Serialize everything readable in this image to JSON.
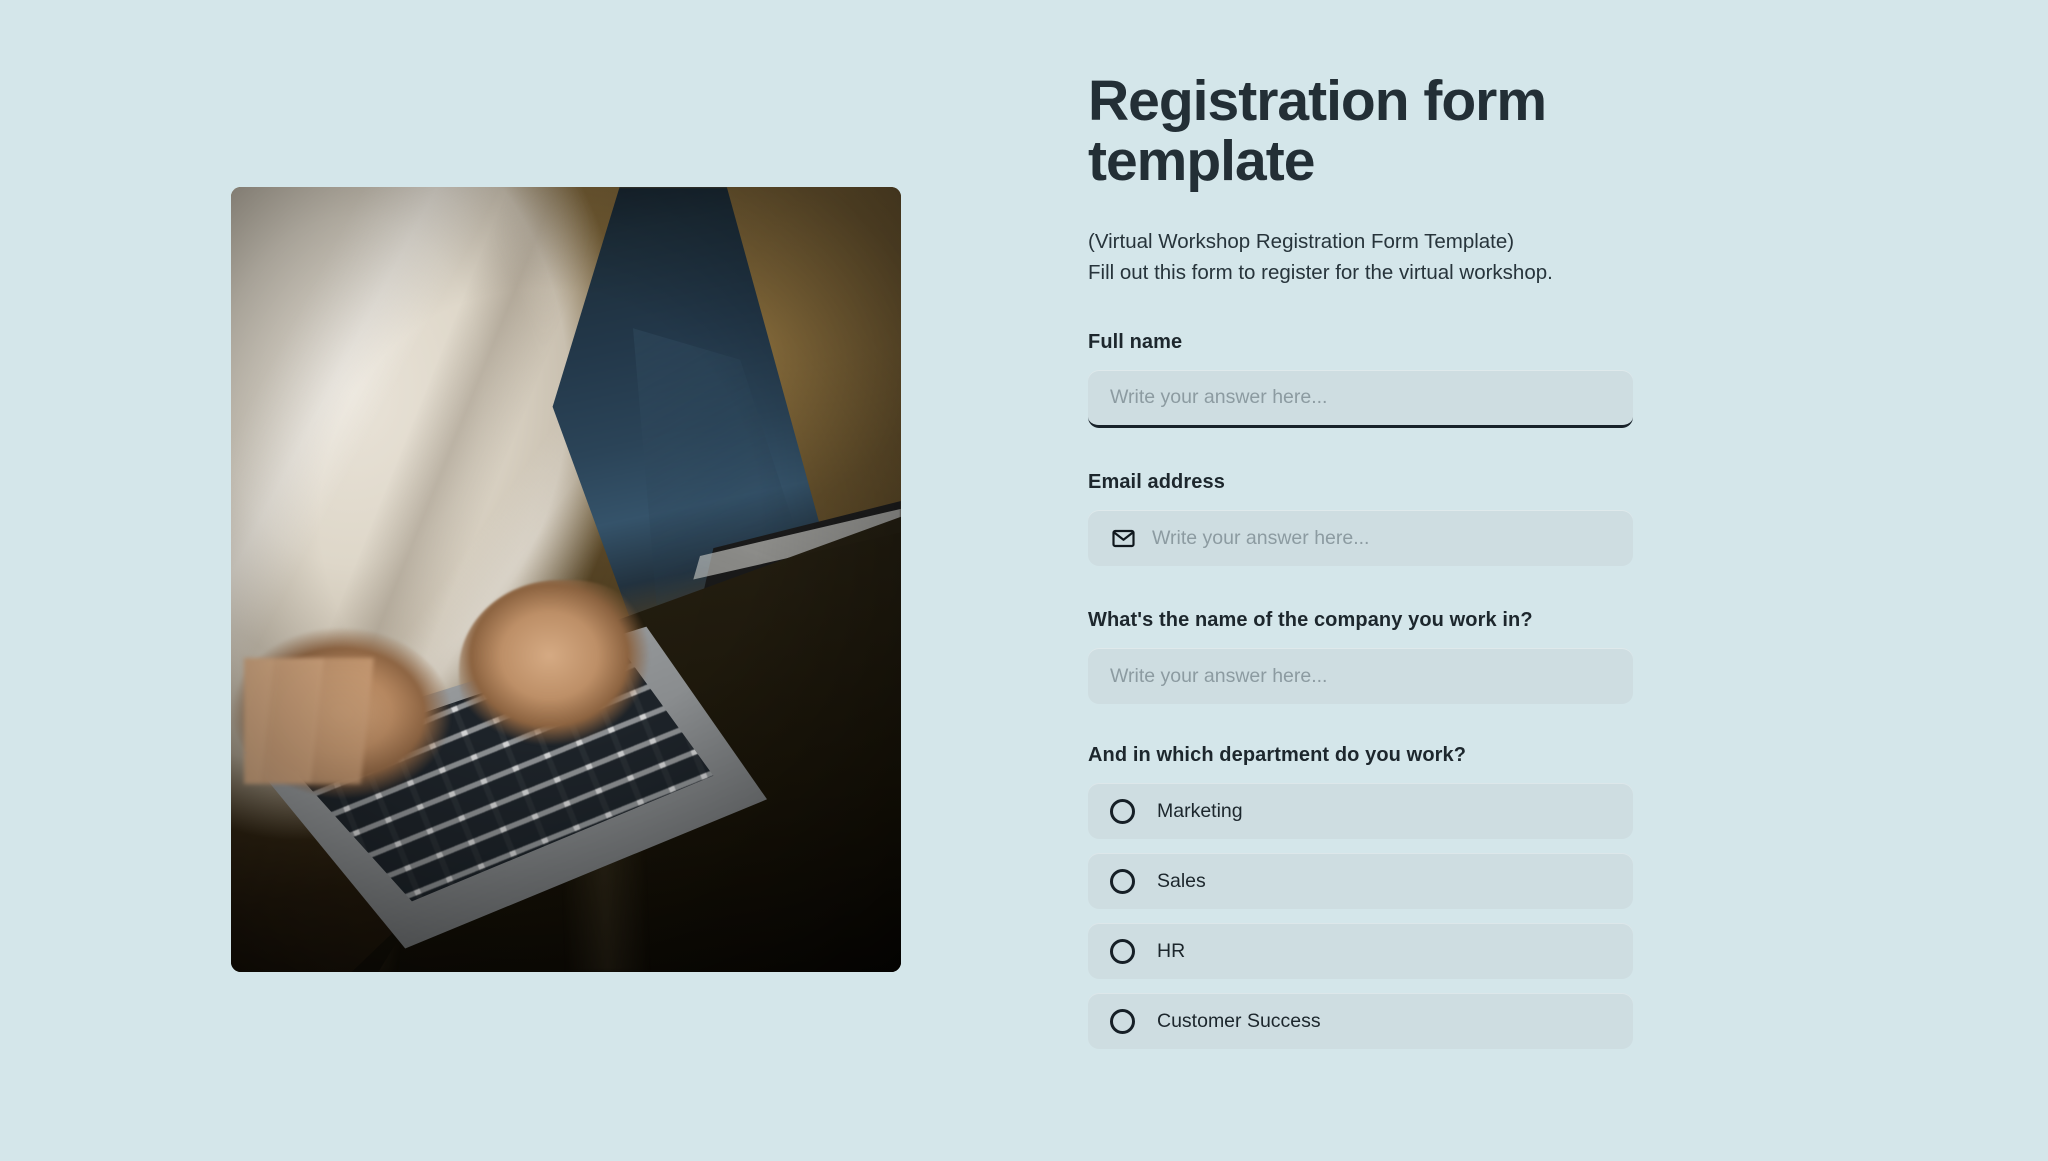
{
  "page": {
    "background_color": "#d4e6ea",
    "text_color": "#232f36",
    "field_background": "#cedde1",
    "placeholder_color": "#8c9ba1",
    "focus_border_color": "#18222a"
  },
  "media": {
    "alt": "Person in a white shirt with a dark navy sleeve typing on a silver laptop resting on dark trousers, warm olive-brown background"
  },
  "header": {
    "title": "Registration form template",
    "subtitle_line_1": "(Virtual Workshop Registration Form Template)",
    "subtitle_line_2": "Fill out this form to register for the virtual workshop."
  },
  "fields": [
    {
      "id": "full-name",
      "label": "Full name",
      "placeholder": "Write your answer here...",
      "value": "",
      "icon": null,
      "focused": true
    },
    {
      "id": "email-address",
      "label": "Email address",
      "placeholder": "Write your answer here...",
      "value": "",
      "icon": "envelope-icon",
      "focused": false
    },
    {
      "id": "company-name",
      "label": "What's the name of the company you work in?",
      "placeholder": "Write your answer here...",
      "value": "",
      "icon": null,
      "focused": false
    }
  ],
  "department_question": {
    "label": "And in which department do you work?",
    "selected": null,
    "options": [
      {
        "id": "marketing",
        "label": "Marketing",
        "selected": false
      },
      {
        "id": "sales",
        "label": "Sales",
        "selected": false
      },
      {
        "id": "hr",
        "label": "HR",
        "selected": false
      },
      {
        "id": "customer-success",
        "label": "Customer Success",
        "selected": false
      }
    ]
  }
}
